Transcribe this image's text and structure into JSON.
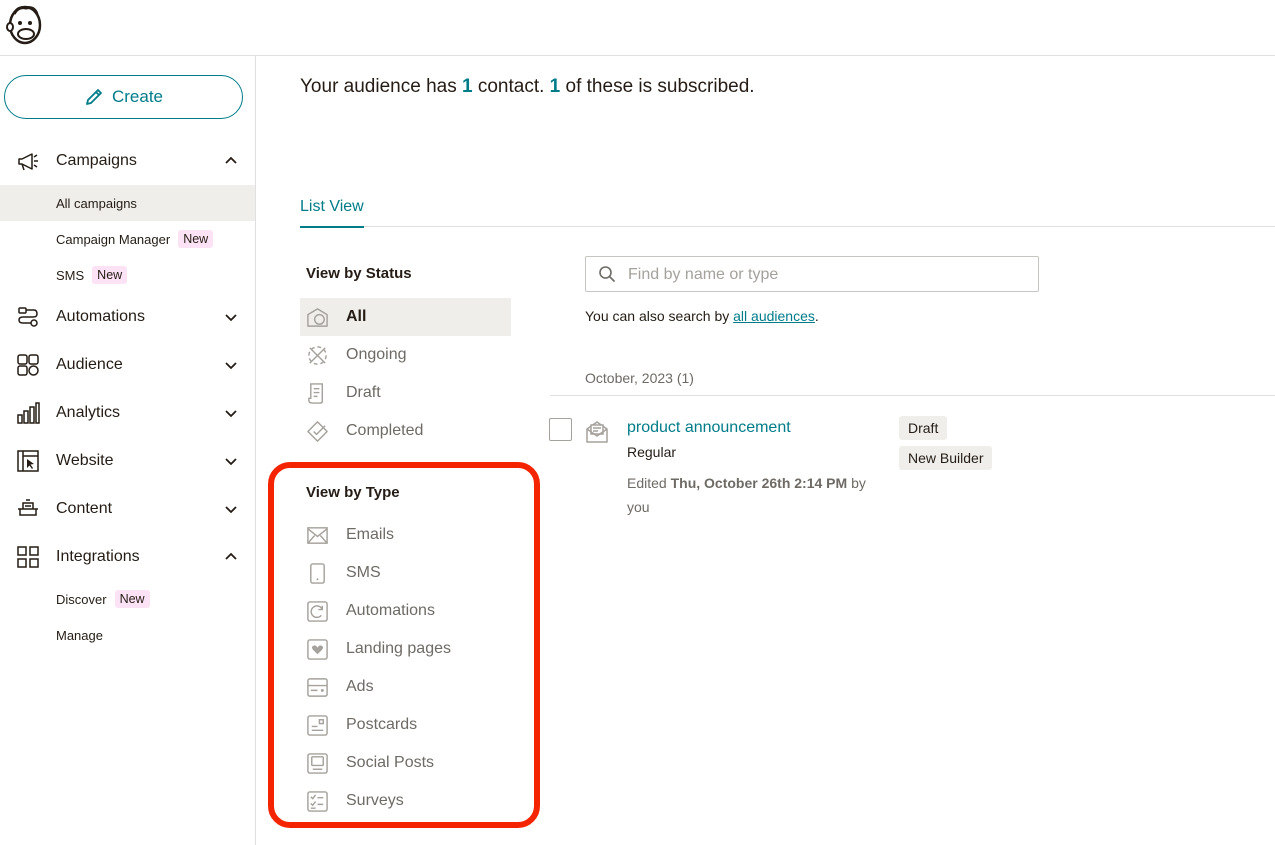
{
  "sidebar": {
    "create_label": "Create",
    "nav": [
      {
        "label": "Campaigns"
      },
      {
        "label": "Automations"
      },
      {
        "label": "Audience"
      },
      {
        "label": "Analytics"
      },
      {
        "label": "Website"
      },
      {
        "label": "Content"
      },
      {
        "label": "Integrations"
      }
    ],
    "campaign_sub": [
      {
        "label": "All campaigns"
      },
      {
        "label": "Campaign Manager",
        "badge": "New"
      },
      {
        "label": "SMS",
        "badge": "New"
      }
    ],
    "integration_sub": [
      {
        "label": "Discover",
        "badge": "New"
      },
      {
        "label": "Manage"
      }
    ]
  },
  "summary": {
    "prefix": "Your audience has ",
    "contacts": "1",
    "middle": " contact. ",
    "subscribed": "1",
    "suffix": " of these is subscribed."
  },
  "tabs": {
    "active": "List View"
  },
  "status_filter": {
    "heading": "View by Status",
    "items": [
      {
        "label": "All",
        "icon": "all-icon"
      },
      {
        "label": "Ongoing",
        "icon": "ongoing-icon"
      },
      {
        "label": "Draft",
        "icon": "draft-icon"
      },
      {
        "label": "Completed",
        "icon": "completed-icon"
      }
    ]
  },
  "type_filter": {
    "heading": "View by Type",
    "items": [
      {
        "label": "Emails",
        "icon": "email-icon"
      },
      {
        "label": "SMS",
        "icon": "phone-icon"
      },
      {
        "label": "Automations",
        "icon": "automation-icon"
      },
      {
        "label": "Landing pages",
        "icon": "heart-page-icon"
      },
      {
        "label": "Ads",
        "icon": "ads-icon"
      },
      {
        "label": "Postcards",
        "icon": "postcard-icon"
      },
      {
        "label": "Social Posts",
        "icon": "social-post-icon"
      },
      {
        "label": "Surveys",
        "icon": "survey-icon"
      }
    ]
  },
  "search": {
    "placeholder": "Find by name or type",
    "hint_prefix": "You can also search by ",
    "hint_link": "all audiences",
    "hint_suffix": "."
  },
  "list": {
    "group_label": "October, 2023 (1)",
    "campaign": {
      "title": "product announcement",
      "type": "Regular",
      "edited_prefix": "Edited ",
      "edited_date": "Thu, October 26th 2:14 PM",
      "edited_suffix": " by you",
      "tags": [
        "Draft",
        "New Builder"
      ]
    }
  },
  "colors": {
    "accent": "#007c89",
    "highlight": "#f52400",
    "badge": "#fbe2f5"
  }
}
